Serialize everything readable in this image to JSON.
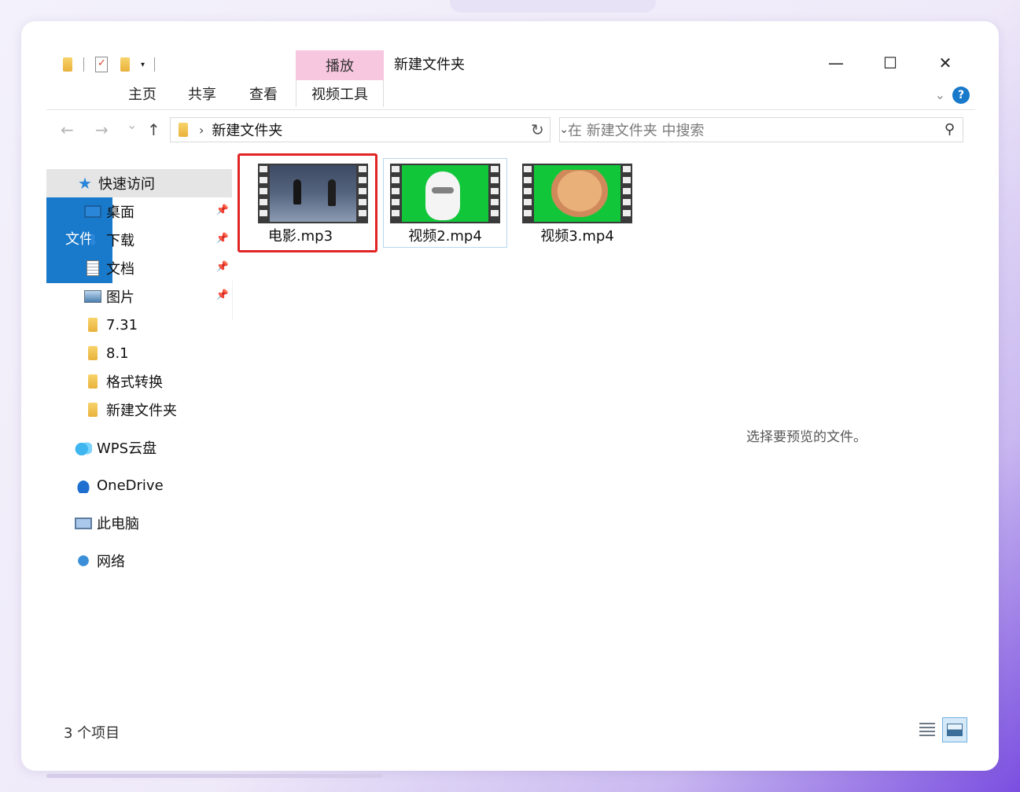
{
  "window": {
    "title": "新建文件夹",
    "context_tab_header": "播放",
    "controls": {
      "minimize": "—",
      "maximize": "☐",
      "close": "✕"
    }
  },
  "ribbon": {
    "tabs": [
      "文件",
      "主页",
      "共享",
      "查看",
      "视频工具"
    ]
  },
  "navigation": {
    "back": "←",
    "forward": "→",
    "recent": "⌄",
    "up": "↑",
    "breadcrumb_separator": "›",
    "path": "新建文件夹",
    "refresh": "↻",
    "search_placeholder": "在 新建文件夹 中搜索"
  },
  "sidebar": {
    "quick_access": "快速访问",
    "pinned": [
      {
        "label": "桌面",
        "icon": "desktop-icon"
      },
      {
        "label": "下载",
        "icon": "download-icon"
      },
      {
        "label": "文档",
        "icon": "document-icon"
      },
      {
        "label": "图片",
        "icon": "pictures-icon"
      }
    ],
    "folders": [
      "7.31",
      "8.1",
      "格式转换",
      "新建文件夹"
    ],
    "locations": [
      {
        "label": "WPS云盘",
        "icon": "wps-cloud-icon"
      },
      {
        "label": "OneDrive",
        "icon": "onedrive-icon"
      },
      {
        "label": "此电脑",
        "icon": "this-pc-icon"
      },
      {
        "label": "网络",
        "icon": "network-icon"
      }
    ]
  },
  "files": [
    {
      "name": "电影.mp3",
      "thumbnail": "movie-scene",
      "selected_highlight": true
    },
    {
      "name": "视频2.mp4",
      "thumbnail": "white-cat-green-screen",
      "selected_highlight": false
    },
    {
      "name": "视频3.mp4",
      "thumbnail": "orange-cat-green-screen",
      "selected_highlight": false
    }
  ],
  "preview_pane_message": "选择要预览的文件。",
  "status_bar": {
    "item_count": "3 个项目"
  },
  "colors": {
    "accent": "#1979ca",
    "context_tab": "#f7c6df",
    "highlight_box": "#e12424",
    "green_screen": "#12c63a"
  }
}
